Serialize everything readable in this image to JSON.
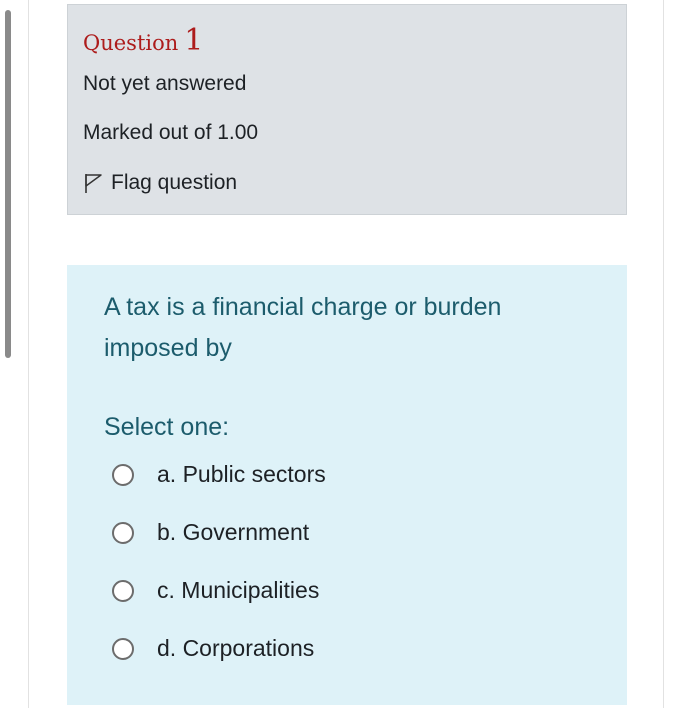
{
  "question_info": {
    "title_word": "Question",
    "number": "1",
    "status": "Not yet answered",
    "marks": "Marked out of 1.00",
    "flag_label": "Flag question"
  },
  "question": {
    "text": "A tax is a financial charge or burden imposed by",
    "prompt": "Select one:",
    "options": [
      {
        "label": "a. Public sectors",
        "selected": false
      },
      {
        "label": "b. Government",
        "selected": false
      },
      {
        "label": "c. Municipalities",
        "selected": false
      },
      {
        "label": "d. Corporations",
        "selected": false
      }
    ]
  },
  "colors": {
    "info_background": "#dee2e6",
    "content_background": "#def2f8",
    "question_title": "#ad1c1c",
    "question_text": "#1c5c6c"
  },
  "icons": {
    "flag": "flag-outline-icon",
    "radio": "radio-unchecked"
  }
}
